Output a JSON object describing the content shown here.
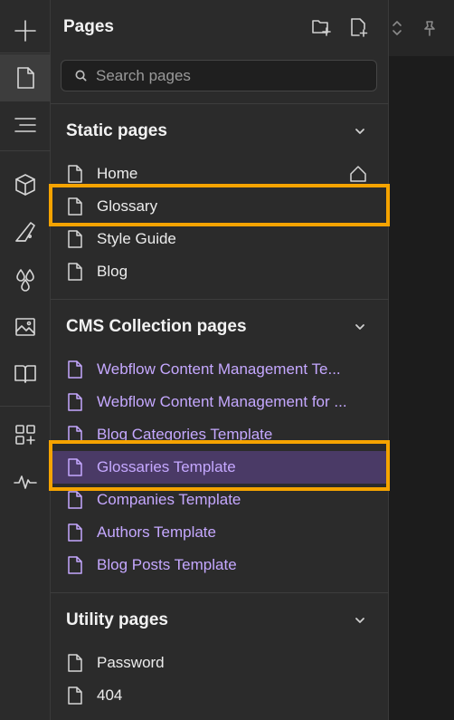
{
  "panel": {
    "title": "Pages",
    "new_folder_icon": "folder-plus-icon",
    "new_page_icon": "file-plus-icon"
  },
  "search": {
    "placeholder": "Search pages"
  },
  "rail": {
    "icons": [
      "plus-icon",
      "page-icon",
      "navigator-icon",
      "box-icon",
      "style-icon",
      "drops-icon",
      "image-icon",
      "book-icon",
      "apps-icon",
      "activity-icon"
    ]
  },
  "sections": {
    "static": {
      "title": "Static pages",
      "items": [
        {
          "label": "Home",
          "home": true
        },
        {
          "label": "Glossary"
        },
        {
          "label": "Style Guide"
        },
        {
          "label": "Blog"
        }
      ]
    },
    "cms": {
      "title": "CMS Collection pages",
      "items": [
        {
          "label": "Webflow Content Management Te..."
        },
        {
          "label": "Webflow Content Management for ..."
        },
        {
          "label": "Blog Categories Template"
        },
        {
          "label": "Glossaries Template",
          "selected": true
        },
        {
          "label": "Companies Template"
        },
        {
          "label": "Authors Template"
        },
        {
          "label": "Blog Posts Template"
        }
      ]
    },
    "utility": {
      "title": "Utility pages",
      "items": [
        {
          "label": "Password"
        },
        {
          "label": "404"
        }
      ]
    }
  },
  "colors": {
    "highlight": "#f5a300",
    "cms_link": "#c5a8ff",
    "selected_row": "#4a3a66"
  }
}
